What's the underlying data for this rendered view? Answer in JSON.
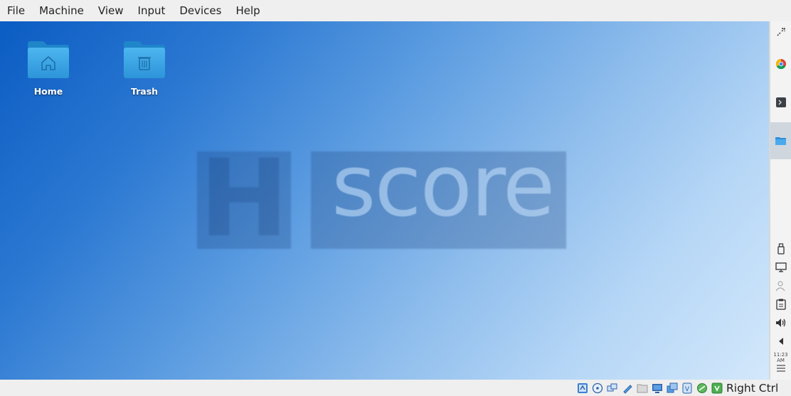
{
  "menu": {
    "items": [
      "File",
      "Machine",
      "View",
      "Input",
      "Devices",
      "Help"
    ]
  },
  "desktop": {
    "icons": [
      {
        "label": "Home",
        "icon": "home-folder-icon"
      },
      {
        "label": "Trash",
        "icon": "trash-folder-icon"
      }
    ],
    "wallpaper": {
      "letter": "H",
      "word": "score",
      "colors": {
        "start": "#0b5cc3",
        "end": "#d3e8fb"
      }
    }
  },
  "side_panel": {
    "icons": [
      "arrow-expand-icon",
      "chrome-icon",
      "terminal-icon",
      "file-manager-icon",
      "usb-icon",
      "display-icon",
      "user-icon",
      "clipboard-icon",
      "volume-icon",
      "collapse-arrow-icon",
      "menu-icon"
    ],
    "clock": "11:23 AM"
  },
  "status_bar": {
    "icons": [
      "hard-disk-icon",
      "optical-drive-icon",
      "network-icon",
      "usb-status-icon",
      "shared-folders-icon",
      "display-status-icon",
      "video-capture-icon",
      "recording-icon",
      "cpu-icon",
      "mouse-integration-icon"
    ],
    "host_key": "Right Ctrl"
  }
}
